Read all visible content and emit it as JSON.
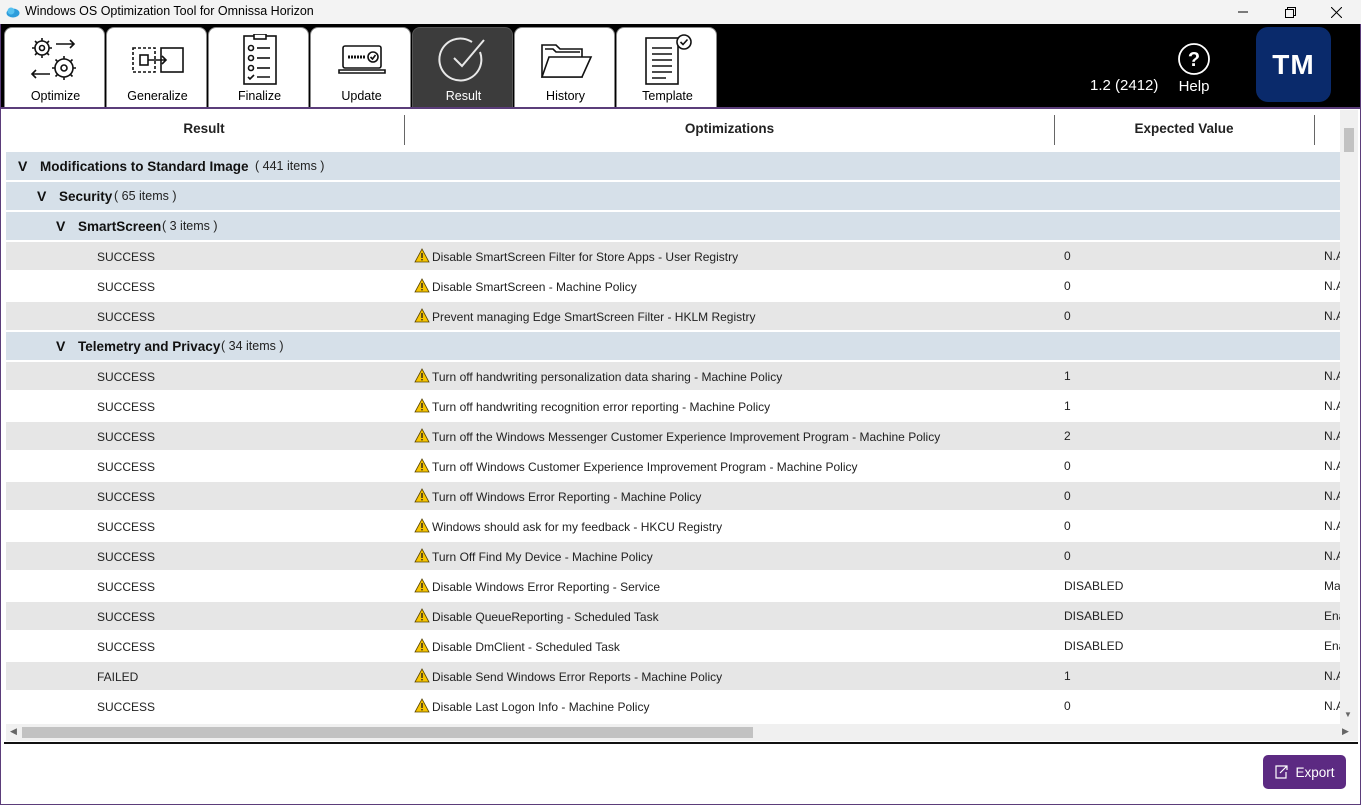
{
  "window": {
    "title": "Windows OS Optimization Tool for Omnissa Horizon",
    "minimize_icon": "minimize-icon",
    "restore_icon": "restore-icon",
    "close_icon": "close-icon"
  },
  "toolbar": {
    "tabs": [
      {
        "label": "Optimize",
        "icon": "gears-arrows-icon"
      },
      {
        "label": "Generalize",
        "icon": "generalize-icon"
      },
      {
        "label": "Finalize",
        "icon": "checklist-icon"
      },
      {
        "label": "Update",
        "icon": "update-icon"
      },
      {
        "label": "Result",
        "icon": "result-check-icon",
        "active": true
      },
      {
        "label": "History",
        "icon": "folder-icon"
      },
      {
        "label": "Template",
        "icon": "template-icon"
      }
    ],
    "version": "1.2 (2412)",
    "help_label": "Help",
    "avatar_initials": "TM"
  },
  "table": {
    "headers": {
      "result": "Result",
      "optimizations": "Optimizations",
      "expected_value": "Expected Value"
    },
    "groups": {
      "root": {
        "title": "Modifications to Standard Image",
        "count": "( 441  items )"
      },
      "security": {
        "title": "Security",
        "count": "( 65  items )"
      },
      "smartscreen": {
        "title": "SmartScreen",
        "count": "( 3  items )"
      },
      "telemetry": {
        "title": "Telemetry and Privacy",
        "count": "( 34  items )"
      }
    },
    "rows": [
      {
        "status": "SUCCESS",
        "optimization": "Disable SmartScreen Filter for Store Apps - User Registry",
        "expected": "0",
        "current": "N.A"
      },
      {
        "status": "SUCCESS",
        "optimization": "Disable SmartScreen - Machine Policy",
        "expected": "0",
        "current": "N.A"
      },
      {
        "status": "SUCCESS",
        "optimization": "Prevent managing Edge SmartScreen Filter - HKLM Registry",
        "expected": "0",
        "current": "N.A"
      },
      {
        "status": "SUCCESS",
        "optimization": "Turn off handwriting personalization data sharing - Machine Policy",
        "expected": "1",
        "current": "N.A"
      },
      {
        "status": "SUCCESS",
        "optimization": "Turn off handwriting recognition error reporting - Machine Policy",
        "expected": "1",
        "current": "N.A"
      },
      {
        "status": "SUCCESS",
        "optimization": "Turn off the Windows Messenger Customer Experience Improvement Program - Machine Policy",
        "expected": "2",
        "current": "N.A"
      },
      {
        "status": "SUCCESS",
        "optimization": "Turn off Windows Customer Experience Improvement Program - Machine Policy",
        "expected": "0",
        "current": "N.A"
      },
      {
        "status": "SUCCESS",
        "optimization": "Turn off Windows Error Reporting - Machine Policy",
        "expected": "0",
        "current": "N.A"
      },
      {
        "status": "SUCCESS",
        "optimization": "Windows should ask for my feedback - HKCU Registry",
        "expected": "0",
        "current": "N.A"
      },
      {
        "status": "SUCCESS",
        "optimization": "Turn Off Find My Device - Machine Policy",
        "expected": "0",
        "current": "N.A"
      },
      {
        "status": "SUCCESS",
        "optimization": "Disable Windows Error Reporting - Service",
        "expected": "DISABLED",
        "current": "Ma"
      },
      {
        "status": "SUCCESS",
        "optimization": "Disable QueueReporting - Scheduled Task",
        "expected": "DISABLED",
        "current": "Ena"
      },
      {
        "status": "SUCCESS",
        "optimization": "Disable DmClient - Scheduled Task",
        "expected": "DISABLED",
        "current": "Ena"
      },
      {
        "status": "FAILED",
        "optimization": "Disable Send Windows Error Reports - Machine Policy",
        "expected": "1",
        "current": "N.A"
      },
      {
        "status": "SUCCESS",
        "optimization": "Disable Last Logon Info - Machine Policy",
        "expected": "0",
        "current": "N.A"
      }
    ],
    "warning_icon": "warning-icon",
    "expand_glyph": "V"
  },
  "footer": {
    "export_label": "Export",
    "export_icon": "export-icon"
  },
  "colors": {
    "toolbar_bg": "#000000",
    "accent": "#5c2a82",
    "group_bg": "#d6e0e9",
    "avatar_bg": "#0a2a6b"
  }
}
